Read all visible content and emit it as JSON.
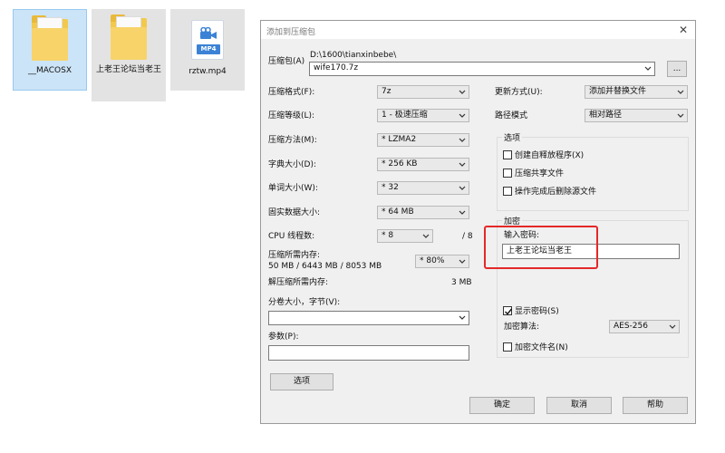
{
  "desktop": {
    "files": [
      {
        "name": "__MACOSX"
      },
      {
        "name": "上老王论坛当老王"
      },
      {
        "name": "rztw.mp4",
        "badge": "MP4"
      }
    ]
  },
  "dialog": {
    "title": "添加到压缩包",
    "archive": {
      "label": "压缩包(A)",
      "path": "D:\\1600\\tianxinbebe\\",
      "value": "wife170.7z",
      "browse": "..."
    },
    "left": {
      "format": {
        "label": "压缩格式(F):",
        "value": "7z"
      },
      "level": {
        "label": "压缩等级(L):",
        "value": "1 - 极速压缩"
      },
      "method": {
        "label": "压缩方法(M):",
        "value": "* LZMA2"
      },
      "dict": {
        "label": "字典大小(D):",
        "value": "* 256 KB"
      },
      "word": {
        "label": "单词大小(W):",
        "value": "* 32"
      },
      "solid": {
        "label": "固实数据大小:",
        "value": "* 64 MB"
      },
      "cpu": {
        "label": "CPU 线程数:",
        "value": "* 8",
        "max": "/ 8"
      },
      "mem_compress": {
        "label": "压缩所需内存:",
        "detail": "50 MB / 6443 MB / 8053 MB",
        "value": "* 80%"
      },
      "mem_decompress": {
        "label": "解压缩所需内存:",
        "value": "3 MB"
      },
      "split": {
        "label": "分卷大小，字节(V):",
        "value": ""
      },
      "params": {
        "label": "参数(P):",
        "value": ""
      },
      "options_button": "选项"
    },
    "right": {
      "update": {
        "label": "更新方式(U):",
        "value": "添加并替换文件"
      },
      "pathmode": {
        "label": "路径模式",
        "value": "相对路径"
      },
      "options_group": {
        "title": "选项",
        "sfx": "创建自释放程序(X)",
        "shared": "压缩共享文件",
        "delete": "操作完成后删除源文件"
      },
      "encryption": {
        "title": "加密",
        "pwd_label": "输入密码:",
        "pwd_value": "上老王论坛当老王",
        "show_pwd": "显示密码(S)",
        "method_label": "加密算法:",
        "method_value": "AES-256",
        "encrypt_names": "加密文件名(N)"
      }
    },
    "buttons": {
      "ok": "确定",
      "cancel": "取消",
      "help": "帮助"
    }
  }
}
